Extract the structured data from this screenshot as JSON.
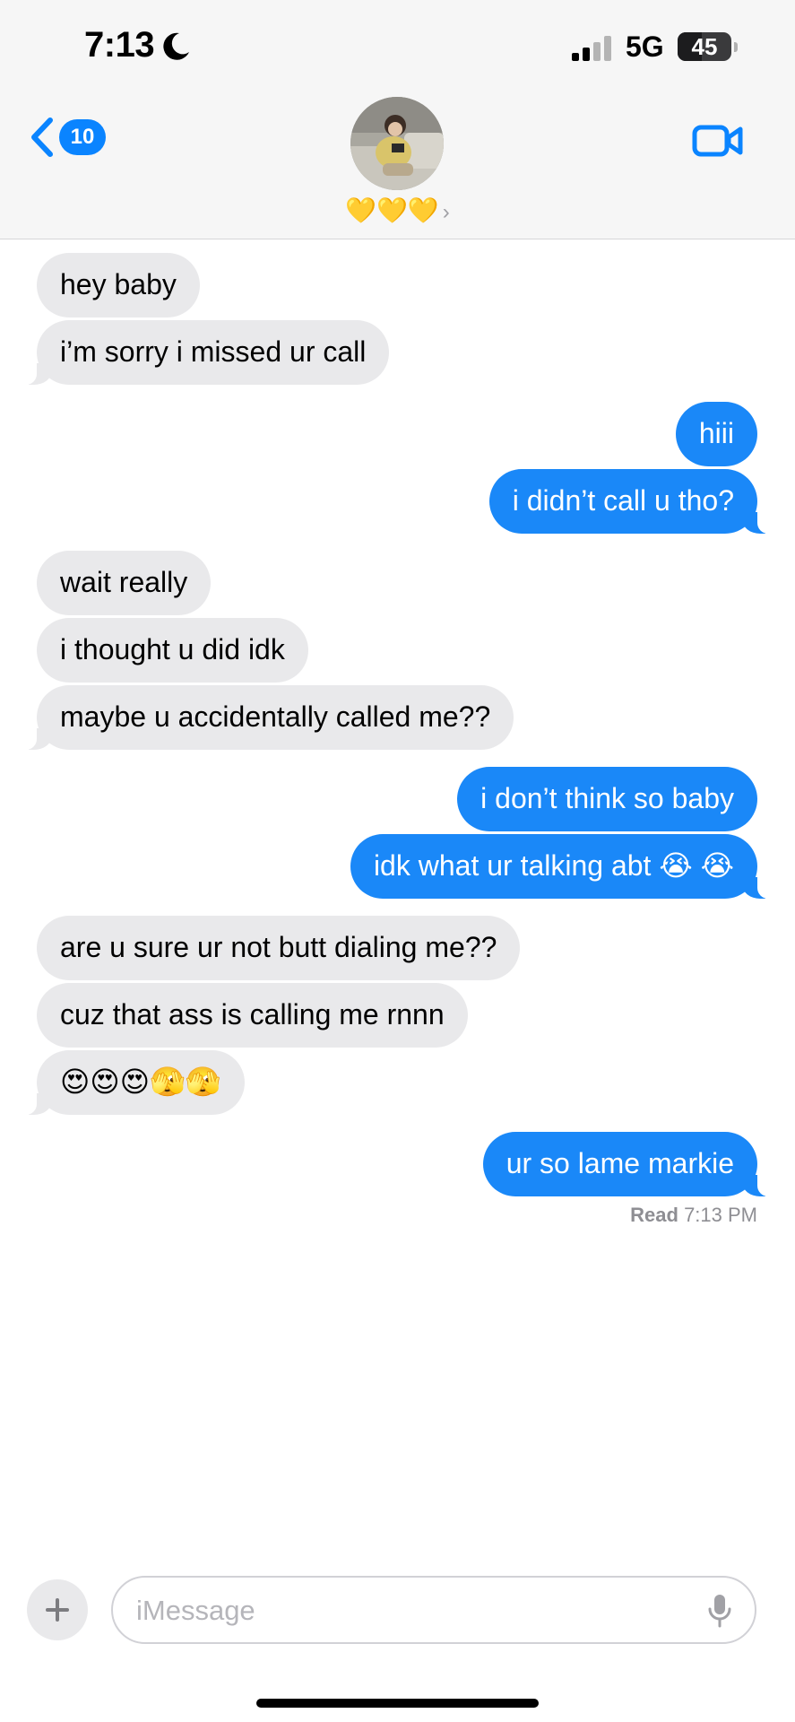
{
  "status_bar": {
    "time": "7:13",
    "network": "5G",
    "battery": "45",
    "battery_level_percent": 45,
    "signal_bars_active": 2,
    "signal_bars_total": 4
  },
  "header": {
    "back_count": "10",
    "contact_name": "💛💛💛",
    "contact_chevron": "›"
  },
  "messages": [
    {
      "dir": "in",
      "text": "hey baby"
    },
    {
      "dir": "in",
      "text": "i’m sorry i missed ur call"
    },
    {
      "dir": "out",
      "text": "hiii"
    },
    {
      "dir": "out",
      "text": "i didn’t call u tho?"
    },
    {
      "dir": "in",
      "text": "wait really"
    },
    {
      "dir": "in",
      "text": "i thought u did idk"
    },
    {
      "dir": "in",
      "text": "maybe u accidentally called me??"
    },
    {
      "dir": "out",
      "text": "i don’t think so baby"
    },
    {
      "dir": "out",
      "text": "idk what ur talking abt 😭 😭"
    },
    {
      "dir": "in",
      "text": "are u sure ur not butt dialing me??"
    },
    {
      "dir": "in",
      "text": "cuz that ass is calling me rnnn"
    },
    {
      "dir": "in",
      "text": "😍😍😍🫣🫣"
    },
    {
      "dir": "out",
      "text": "ur so lame markie"
    }
  ],
  "read_receipt": {
    "label": "Read",
    "time": "7:13 PM"
  },
  "composer": {
    "placeholder": "iMessage"
  },
  "colors": {
    "outgoing": "#1a88f8",
    "incoming": "#e9e9eb",
    "accent": "#0a84ff"
  }
}
